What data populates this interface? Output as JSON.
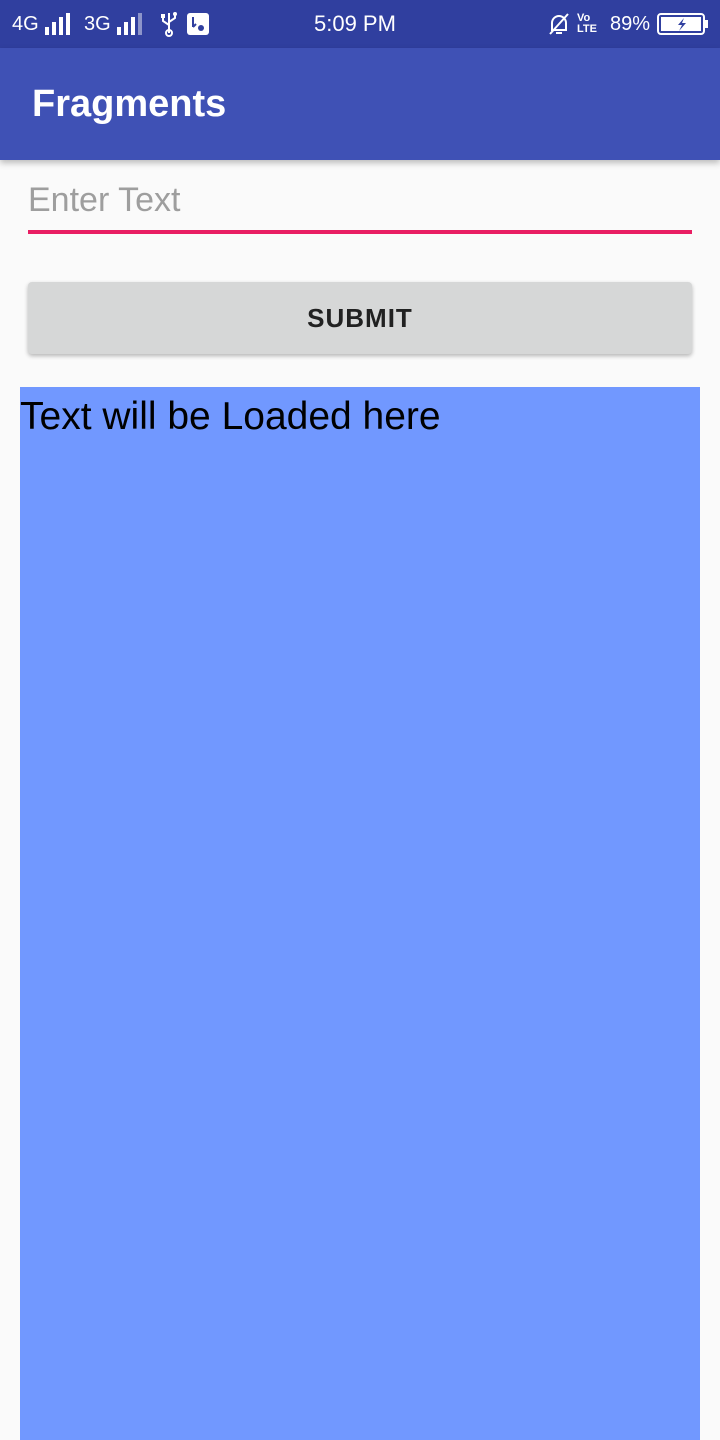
{
  "status_bar": {
    "network_1": "4G",
    "network_2": "3G",
    "time": "5:09 PM",
    "volte": "Vo LTE",
    "battery": "89%",
    "icons": [
      "signal-icon",
      "usb-icon",
      "notification-icon",
      "alarm-off-icon",
      "battery-charging-icon"
    ]
  },
  "app_bar": {
    "title": "Fragments"
  },
  "form": {
    "input_placeholder": "Enter Text",
    "input_value": "",
    "submit_label": "SUBMIT"
  },
  "fragment": {
    "text": "Text will be Loaded here"
  },
  "colors": {
    "status_bar": "#303f9f",
    "app_bar": "#3f51b5",
    "accent": "#e91e63",
    "button": "#d6d7d7",
    "fragment_bg": "#7198ff"
  }
}
